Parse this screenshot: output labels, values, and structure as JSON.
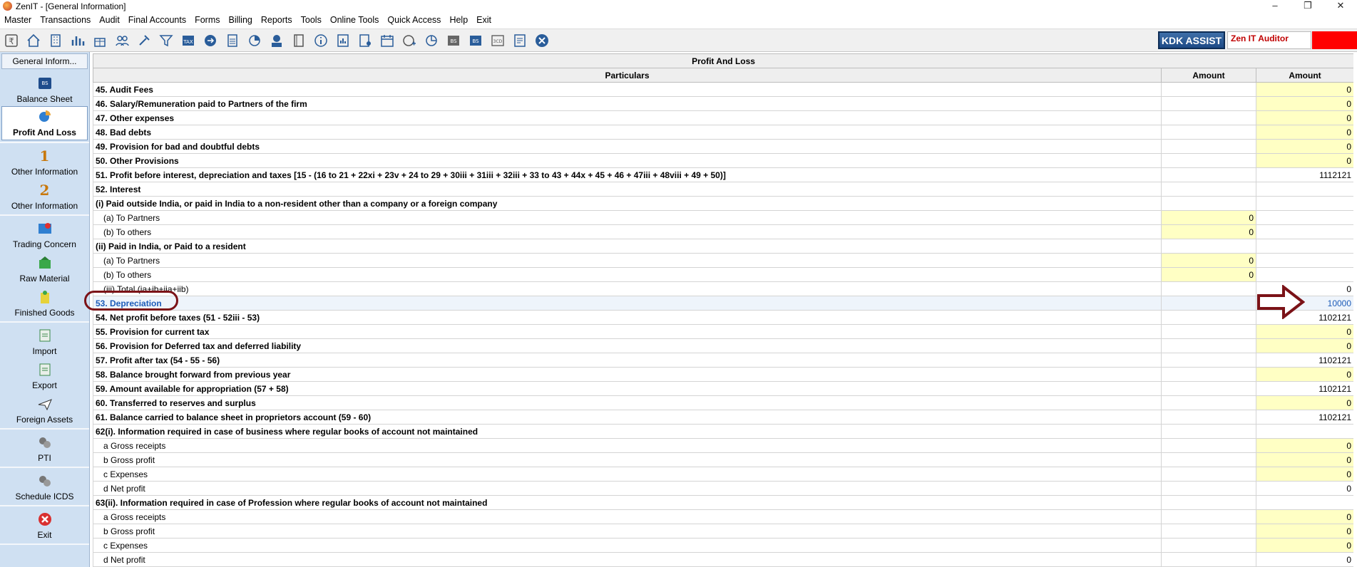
{
  "window": {
    "title": "ZenIT - [General Information]",
    "controls": [
      "–",
      "❐",
      "✕"
    ]
  },
  "menu": [
    "Master",
    "Transactions",
    "Audit",
    "Final Accounts",
    "Forms",
    "Billing",
    "Reports",
    "Tools",
    "Online Tools",
    "Quick Access",
    "Help",
    "Exit"
  ],
  "toolbar": {
    "kdk_label": "KDK ASSIST",
    "auditor_label": "Zen IT Auditor"
  },
  "sidebar": {
    "tab": "General Inform...",
    "groups": [
      [
        {
          "label": "Balance Sheet",
          "icon": "balance-sheet-icon"
        },
        {
          "label": "Profit And Loss",
          "icon": "pie-chart-icon",
          "active": true
        }
      ],
      [
        {
          "label": "Other Information",
          "icon": "number-1-icon",
          "num": "1"
        },
        {
          "label": "Other Information",
          "icon": "number-2-icon",
          "num": "2"
        }
      ],
      [
        {
          "label": "Trading Concern",
          "icon": "trading-icon"
        },
        {
          "label": "Raw Material",
          "icon": "raw-material-icon"
        },
        {
          "label": "Finished Goods",
          "icon": "finished-goods-icon"
        }
      ],
      [
        {
          "label": "Import",
          "icon": "import-icon"
        },
        {
          "label": "Export",
          "icon": "export-icon"
        },
        {
          "label": "Foreign Assets",
          "icon": "airplane-icon"
        }
      ],
      [
        {
          "label": "PTI",
          "icon": "gears-icon"
        }
      ],
      [
        {
          "label": "Schedule ICDS",
          "icon": "gears-icon"
        }
      ],
      [
        {
          "label": "Exit",
          "icon": "exit-icon"
        }
      ]
    ]
  },
  "table": {
    "caption": "Profit And Loss",
    "headers": [
      "Particulars",
      "Amount",
      "Amount"
    ],
    "rows": [
      {
        "label": "45. Audit Fees",
        "bold": true,
        "a1": "",
        "a2": "0",
        "y2": true
      },
      {
        "label": "46. Salary/Remuneration paid to Partners of the firm",
        "bold": true,
        "a1": "",
        "a2": "0",
        "y2": true
      },
      {
        "label": "47. Other expenses",
        "bold": true,
        "a1": "",
        "a2": "0",
        "y2": true
      },
      {
        "label": "48. Bad debts",
        "bold": true,
        "a1": "",
        "a2": "0",
        "y2": true
      },
      {
        "label": "49. Provision for bad and doubtful debts",
        "bold": true,
        "a1": "",
        "a2": "0",
        "y2": true
      },
      {
        "label": "50. Other Provisions",
        "bold": true,
        "a1": "",
        "a2": "0",
        "y2": true
      },
      {
        "label": "51. Profit before interest, depreciation and taxes [15 - (16 to 21 + 22xi + 23v + 24 to 29 + 30iii + 31iii + 32iii + 33 to 43 + 44x + 45 + 46 + 47iii + 48viii + 49 + 50)]",
        "bold": true,
        "a1": "",
        "a2": "1112121"
      },
      {
        "label": "52. Interest",
        "bold": true,
        "a1": "",
        "a2": ""
      },
      {
        "label": "(i) Paid outside India, or paid in India to a non-resident other than a company or a foreign company",
        "bold": true,
        "a1": "",
        "a2": ""
      },
      {
        "label": "(a) To Partners",
        "bold": false,
        "a1": "0",
        "y1": true,
        "a2": ""
      },
      {
        "label": "(b) To others",
        "bold": false,
        "a1": "0",
        "y1": true,
        "a2": ""
      },
      {
        "label": "(ii) Paid in India, or Paid to a resident",
        "bold": true,
        "a1": "",
        "a2": ""
      },
      {
        "label": "(a) To Partners",
        "bold": false,
        "a1": "0",
        "y1": true,
        "a2": ""
      },
      {
        "label": "(b) To others",
        "bold": false,
        "a1": "0",
        "y1": true,
        "a2": ""
      },
      {
        "label": "(iii) Total (ia+ib+iia+iib)",
        "bold": false,
        "a1": "",
        "a2": "0"
      },
      {
        "label": "53. Depreciation",
        "bold": true,
        "a1": "",
        "a2": "10000",
        "highlight": true
      },
      {
        "label": "54. Net profit before taxes (51 - 52iii - 53)",
        "bold": true,
        "a1": "",
        "a2": "1102121"
      },
      {
        "label": "55. Provision for current tax",
        "bold": true,
        "a1": "",
        "a2": "0",
        "y2": true
      },
      {
        "label": "56. Provision for Deferred tax  and deferred liability",
        "bold": true,
        "a1": "",
        "a2": "0",
        "y2": true
      },
      {
        "label": "57. Profit after tax (54 - 55 - 56)",
        "bold": true,
        "a1": "",
        "a2": "1102121"
      },
      {
        "label": "58. Balance brought forward from previous year",
        "bold": true,
        "a1": "",
        "a2": "0",
        "y2": true
      },
      {
        "label": "59. Amount available for appropriation (57 + 58)",
        "bold": true,
        "a1": "",
        "a2": "1102121"
      },
      {
        "label": "60. Transferred to reserves and surplus",
        "bold": true,
        "a1": "",
        "a2": "0",
        "y2": true
      },
      {
        "label": "61. Balance carried to balance sheet in proprietors account (59 - 60)",
        "bold": true,
        "a1": "",
        "a2": "1102121"
      },
      {
        "label": "62(i). Information required in case of business where regular books of account not maintained",
        "bold": true,
        "a1": "",
        "a2": ""
      },
      {
        "label": "a Gross receipts",
        "bold": false,
        "a1": "",
        "a2": "0",
        "y2": true
      },
      {
        "label": "b Gross profit",
        "bold": false,
        "a1": "",
        "a2": "0",
        "y2": true
      },
      {
        "label": "c Expenses",
        "bold": false,
        "a1": "",
        "a2": "0",
        "y2": true
      },
      {
        "label": "d Net profit",
        "bold": false,
        "a1": "",
        "a2": "0"
      },
      {
        "label": "63(ii). Information required in case of Profession where regular books of account not maintained",
        "bold": true,
        "a1": "",
        "a2": ""
      },
      {
        "label": "a Gross receipts",
        "bold": false,
        "a1": "",
        "a2": "0",
        "y2": true
      },
      {
        "label": "b Gross profit",
        "bold": false,
        "a1": "",
        "a2": "0",
        "y2": true
      },
      {
        "label": "c Expenses",
        "bold": false,
        "a1": "",
        "a2": "0",
        "y2": true
      },
      {
        "label": "d Net profit",
        "bold": false,
        "a1": "",
        "a2": "0"
      }
    ]
  }
}
